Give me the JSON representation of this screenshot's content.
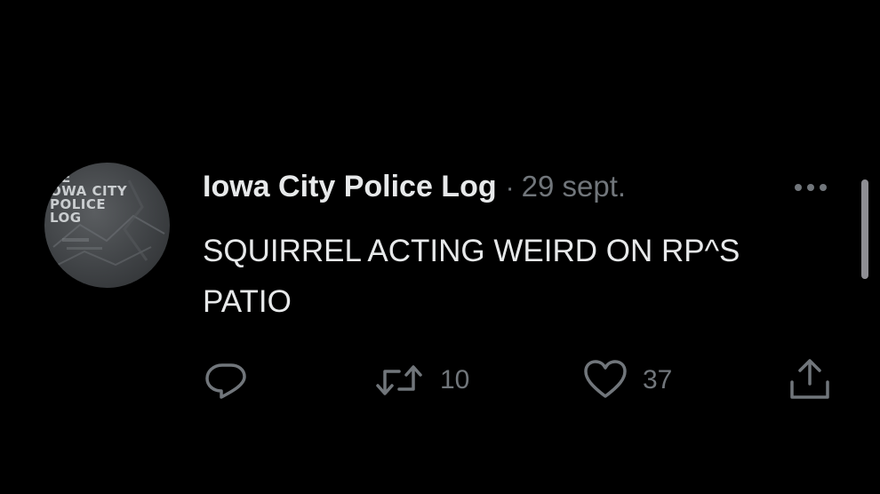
{
  "tweet": {
    "avatar": {
      "icon": "police-log-logo",
      "lines": [
        "HE",
        "OWA CITY",
        "POLICE",
        "LOG"
      ]
    },
    "author": "Iowa City Police Log",
    "separator": "·",
    "date": "29 sept.",
    "more_icon": "more-horizontal-icon",
    "text": "SQUIRREL ACTING WEIRD ON RP^S\nPATIO",
    "actions": {
      "reply": {
        "icon": "reply-icon"
      },
      "retweet": {
        "icon": "retweet-icon",
        "count": "10"
      },
      "like": {
        "icon": "heart-icon",
        "count": "37"
      },
      "share": {
        "icon": "share-icon"
      }
    }
  },
  "colors": {
    "background": "#000000",
    "primary_text": "#e7e9ea",
    "secondary_text": "#71767b",
    "scrollbar": "#8e8e93"
  }
}
